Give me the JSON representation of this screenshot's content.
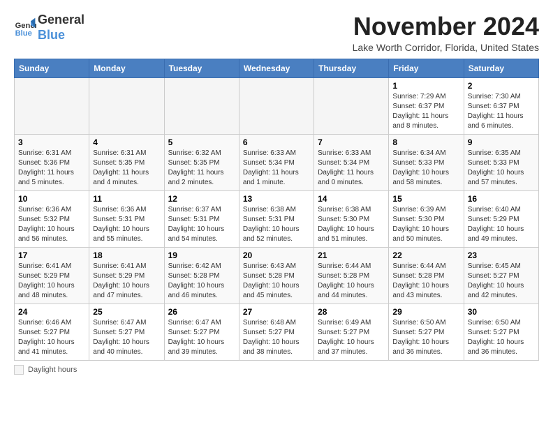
{
  "header": {
    "logo_line1": "General",
    "logo_line2": "Blue",
    "month_title": "November 2024",
    "location": "Lake Worth Corridor, Florida, United States"
  },
  "weekdays": [
    "Sunday",
    "Monday",
    "Tuesday",
    "Wednesday",
    "Thursday",
    "Friday",
    "Saturday"
  ],
  "weeks": [
    [
      {
        "day": "",
        "info": ""
      },
      {
        "day": "",
        "info": ""
      },
      {
        "day": "",
        "info": ""
      },
      {
        "day": "",
        "info": ""
      },
      {
        "day": "",
        "info": ""
      },
      {
        "day": "1",
        "info": "Sunrise: 7:29 AM\nSunset: 6:37 PM\nDaylight: 11 hours and 8 minutes."
      },
      {
        "day": "2",
        "info": "Sunrise: 7:30 AM\nSunset: 6:37 PM\nDaylight: 11 hours and 6 minutes."
      }
    ],
    [
      {
        "day": "3",
        "info": "Sunrise: 6:31 AM\nSunset: 5:36 PM\nDaylight: 11 hours and 5 minutes."
      },
      {
        "day": "4",
        "info": "Sunrise: 6:31 AM\nSunset: 5:35 PM\nDaylight: 11 hours and 4 minutes."
      },
      {
        "day": "5",
        "info": "Sunrise: 6:32 AM\nSunset: 5:35 PM\nDaylight: 11 hours and 2 minutes."
      },
      {
        "day": "6",
        "info": "Sunrise: 6:33 AM\nSunset: 5:34 PM\nDaylight: 11 hours and 1 minute."
      },
      {
        "day": "7",
        "info": "Sunrise: 6:33 AM\nSunset: 5:34 PM\nDaylight: 11 hours and 0 minutes."
      },
      {
        "day": "8",
        "info": "Sunrise: 6:34 AM\nSunset: 5:33 PM\nDaylight: 10 hours and 58 minutes."
      },
      {
        "day": "9",
        "info": "Sunrise: 6:35 AM\nSunset: 5:33 PM\nDaylight: 10 hours and 57 minutes."
      }
    ],
    [
      {
        "day": "10",
        "info": "Sunrise: 6:36 AM\nSunset: 5:32 PM\nDaylight: 10 hours and 56 minutes."
      },
      {
        "day": "11",
        "info": "Sunrise: 6:36 AM\nSunset: 5:31 PM\nDaylight: 10 hours and 55 minutes."
      },
      {
        "day": "12",
        "info": "Sunrise: 6:37 AM\nSunset: 5:31 PM\nDaylight: 10 hours and 54 minutes."
      },
      {
        "day": "13",
        "info": "Sunrise: 6:38 AM\nSunset: 5:31 PM\nDaylight: 10 hours and 52 minutes."
      },
      {
        "day": "14",
        "info": "Sunrise: 6:38 AM\nSunset: 5:30 PM\nDaylight: 10 hours and 51 minutes."
      },
      {
        "day": "15",
        "info": "Sunrise: 6:39 AM\nSunset: 5:30 PM\nDaylight: 10 hours and 50 minutes."
      },
      {
        "day": "16",
        "info": "Sunrise: 6:40 AM\nSunset: 5:29 PM\nDaylight: 10 hours and 49 minutes."
      }
    ],
    [
      {
        "day": "17",
        "info": "Sunrise: 6:41 AM\nSunset: 5:29 PM\nDaylight: 10 hours and 48 minutes."
      },
      {
        "day": "18",
        "info": "Sunrise: 6:41 AM\nSunset: 5:29 PM\nDaylight: 10 hours and 47 minutes."
      },
      {
        "day": "19",
        "info": "Sunrise: 6:42 AM\nSunset: 5:28 PM\nDaylight: 10 hours and 46 minutes."
      },
      {
        "day": "20",
        "info": "Sunrise: 6:43 AM\nSunset: 5:28 PM\nDaylight: 10 hours and 45 minutes."
      },
      {
        "day": "21",
        "info": "Sunrise: 6:44 AM\nSunset: 5:28 PM\nDaylight: 10 hours and 44 minutes."
      },
      {
        "day": "22",
        "info": "Sunrise: 6:44 AM\nSunset: 5:28 PM\nDaylight: 10 hours and 43 minutes."
      },
      {
        "day": "23",
        "info": "Sunrise: 6:45 AM\nSunset: 5:27 PM\nDaylight: 10 hours and 42 minutes."
      }
    ],
    [
      {
        "day": "24",
        "info": "Sunrise: 6:46 AM\nSunset: 5:27 PM\nDaylight: 10 hours and 41 minutes."
      },
      {
        "day": "25",
        "info": "Sunrise: 6:47 AM\nSunset: 5:27 PM\nDaylight: 10 hours and 40 minutes."
      },
      {
        "day": "26",
        "info": "Sunrise: 6:47 AM\nSunset: 5:27 PM\nDaylight: 10 hours and 39 minutes."
      },
      {
        "day": "27",
        "info": "Sunrise: 6:48 AM\nSunset: 5:27 PM\nDaylight: 10 hours and 38 minutes."
      },
      {
        "day": "28",
        "info": "Sunrise: 6:49 AM\nSunset: 5:27 PM\nDaylight: 10 hours and 37 minutes."
      },
      {
        "day": "29",
        "info": "Sunrise: 6:50 AM\nSunset: 5:27 PM\nDaylight: 10 hours and 36 minutes."
      },
      {
        "day": "30",
        "info": "Sunrise: 6:50 AM\nSunset: 5:27 PM\nDaylight: 10 hours and 36 minutes."
      }
    ]
  ],
  "legend": {
    "box_label": "Daylight hours"
  }
}
